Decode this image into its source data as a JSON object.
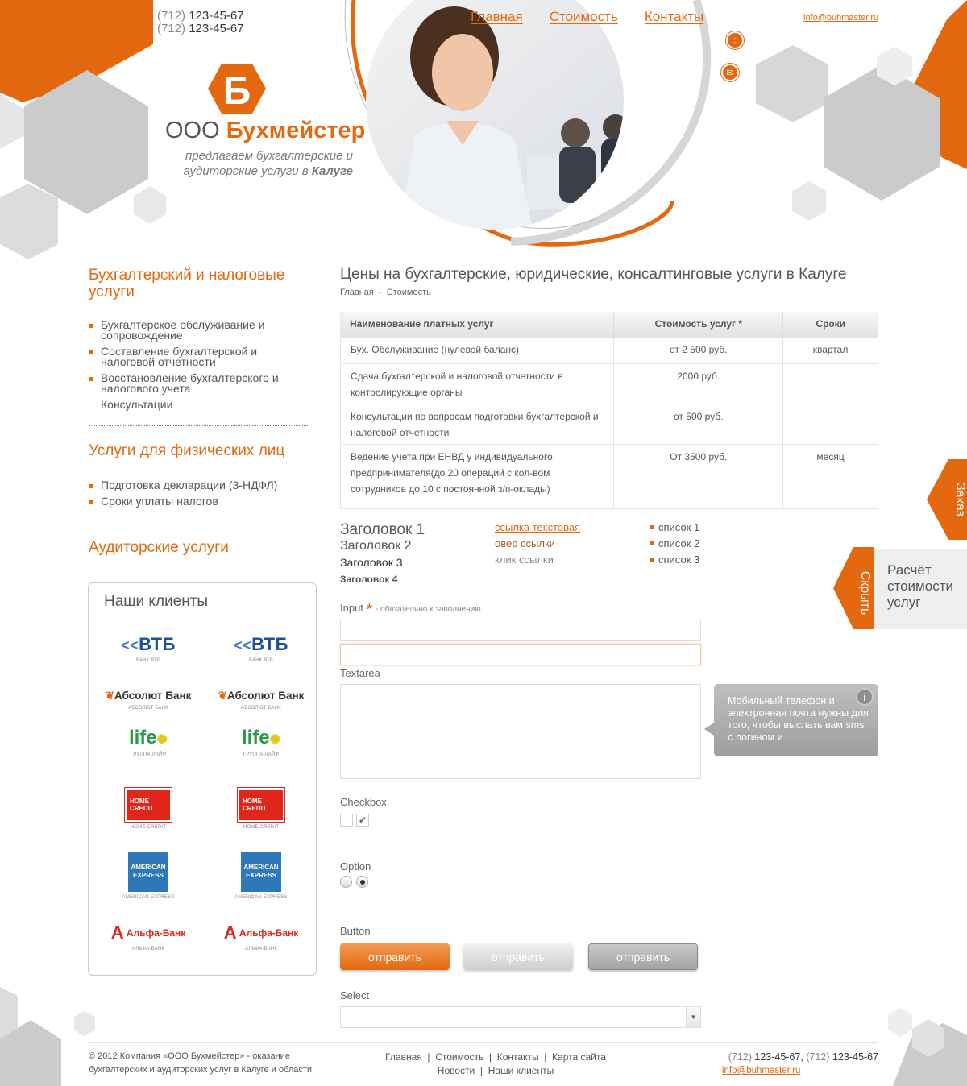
{
  "header": {
    "phone1_code": "(712)",
    "phone1": "123-45-67",
    "phone2_code": "(712)",
    "phone2": "123-45-67",
    "nav": [
      "Главная",
      "Стоимость",
      "Контакты"
    ],
    "email": "info@buhmaster.ru",
    "logo_letter": "Б",
    "logo_prefix": "ООО",
    "logo_name": "Бухмейстер",
    "slogan_line1": "предлагаем бухгалтерские и",
    "slogan_line2": "аудиторские услуги в",
    "slogan_city": "Калуге"
  },
  "sidebar": {
    "section1_title": "Бухгалтерский и налоговые услуги",
    "section1_items": [
      "Бухгалтерское обслуживание и сопровождение",
      "Составление бухгалтерской и налоговой отчетности",
      "Восстановление бухгалтерского и налогового учета",
      "Консультации"
    ],
    "section2_title": "Услуги для физических лиц",
    "section2_items": [
      "Подготовка декларации (3-НДФЛ)",
      "Сроки уплаты налогов"
    ],
    "section3_title": "Аудиторские услуги",
    "clients_title": "Наши клиенты",
    "clients": [
      {
        "logo": "ВТБ",
        "caption": "БАНК ВТБ"
      },
      {
        "logo": "Абсолют Банк",
        "caption": "АБСОЛЮТ БАНК"
      },
      {
        "logo": "life",
        "caption": "ГРУППА ЛАЙФ"
      },
      {
        "logo": "HOME CREDIT",
        "caption": "HOME CREDIT"
      },
      {
        "logo": "AMERICAN EXPRESS",
        "caption": "AMERICAN EXPRESS"
      },
      {
        "logo": "Альфа-Банк",
        "caption": "АЛЬФА-БАНК"
      }
    ]
  },
  "main": {
    "title": "Цены на бухгалтерские, юридические, консалтинговые услуги в Калуге",
    "breadcrumb_home": "Главная",
    "breadcrumb_sep": "-",
    "breadcrumb_current": "Стоимость",
    "table": {
      "headers": [
        "Наименование платных услуг",
        "Стоимость услуг *",
        "Сроки"
      ],
      "rows": [
        [
          "Бух. Обслуживание (нулевой баланс)",
          "от 2 500 руб.",
          "квартал"
        ],
        [
          "Сдача бухгалтерской и налоговой отчетности в контролирующие органы",
          "2000 руб.",
          ""
        ],
        [
          "Консультации по вопросам подготовки бухгалтерской и налоговой отчетности",
          "от 500 руб.",
          ""
        ],
        [
          "Ведение учета при ЕНВД у индивидуального предпринимателя(до 20 операций с кол-вом сотрудников до 10 с постоянной з/п-оклады)",
          "От 3500 руб.",
          "месяц"
        ]
      ]
    },
    "headings": [
      "Заголовок 1",
      "Заголовок 2",
      "Заголовок 3",
      "Заголовок 4"
    ],
    "links": [
      "ссылка текстовая",
      "овер ссылки",
      "клик ссылки"
    ],
    "list": [
      "список 1",
      "список 2",
      "список 3"
    ],
    "input_label": "Input",
    "required_mark": "*",
    "required_note": "- обязательно к заполнению",
    "textarea_label": "Textarea",
    "tooltip_text": "Мобильный телефон и электронная почта нужны для того, чтобы выслать вам sms с логином и",
    "checkbox_label": "Checkbox",
    "option_label": "Option",
    "button_label": "Button",
    "buttons": [
      "отправить",
      "отправить",
      "отправить"
    ],
    "select_label": "Select",
    "select_value": ""
  },
  "side_tabs": {
    "order": "Заказ",
    "hide": "Скрыть",
    "calc": "Расчёт стоимости услуг"
  },
  "footer": {
    "copyright": "© 2012 Компания «ООО Бухмейстер» - оказание бухгалтерских и аудиторских услуг в Калуге и области",
    "links_row1": [
      "Главная",
      "Стоимость",
      "Контакты",
      "Карта сайта"
    ],
    "links_row2": [
      "Новости",
      "Наши клиенты"
    ],
    "phone1_code": "(712)",
    "phone1": "123-45-67",
    "phone2_code": "(712)",
    "phone2": "123-45-67",
    "email": "info@buhmaster.ru"
  },
  "colors": {
    "accent": "#e4680f",
    "gray": "#c9c9c9",
    "text": "#555555"
  }
}
